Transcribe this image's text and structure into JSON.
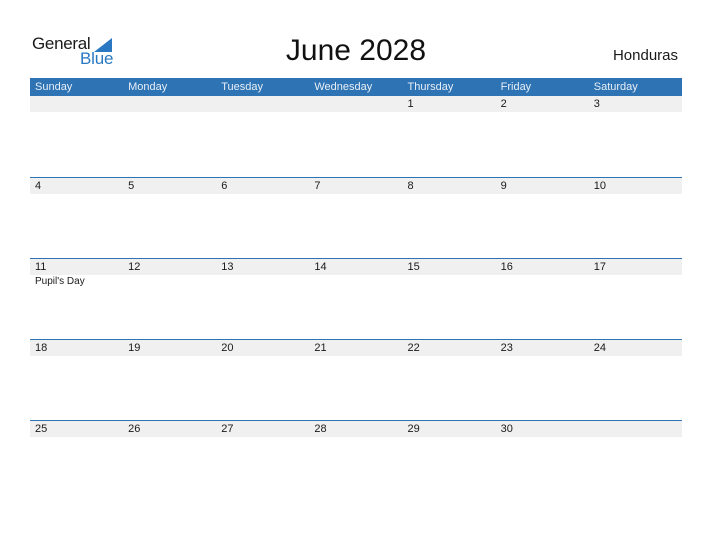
{
  "logo": {
    "word1": "General",
    "word2": "Blue",
    "brand_color": "#2a78c2"
  },
  "title": "June 2028",
  "country": "Honduras",
  "colors": {
    "header_bg": "#2e74b5",
    "daybar_bg": "#f0f0f0"
  },
  "weekdays": [
    "Sunday",
    "Monday",
    "Tuesday",
    "Wednesday",
    "Thursday",
    "Friday",
    "Saturday"
  ],
  "weeks": [
    {
      "days": [
        "",
        "",
        "",
        "",
        "1",
        "2",
        "3"
      ],
      "events": [
        "",
        "",
        "",
        "",
        "",
        "",
        ""
      ]
    },
    {
      "days": [
        "4",
        "5",
        "6",
        "7",
        "8",
        "9",
        "10"
      ],
      "events": [
        "",
        "",
        "",
        "",
        "",
        "",
        ""
      ]
    },
    {
      "days": [
        "11",
        "12",
        "13",
        "14",
        "15",
        "16",
        "17"
      ],
      "events": [
        "Pupil's Day",
        "",
        "",
        "",
        "",
        "",
        ""
      ]
    },
    {
      "days": [
        "18",
        "19",
        "20",
        "21",
        "22",
        "23",
        "24"
      ],
      "events": [
        "",
        "",
        "",
        "",
        "",
        "",
        ""
      ]
    },
    {
      "days": [
        "25",
        "26",
        "27",
        "28",
        "29",
        "30",
        ""
      ],
      "events": [
        "",
        "",
        "",
        "",
        "",
        "",
        ""
      ]
    }
  ]
}
